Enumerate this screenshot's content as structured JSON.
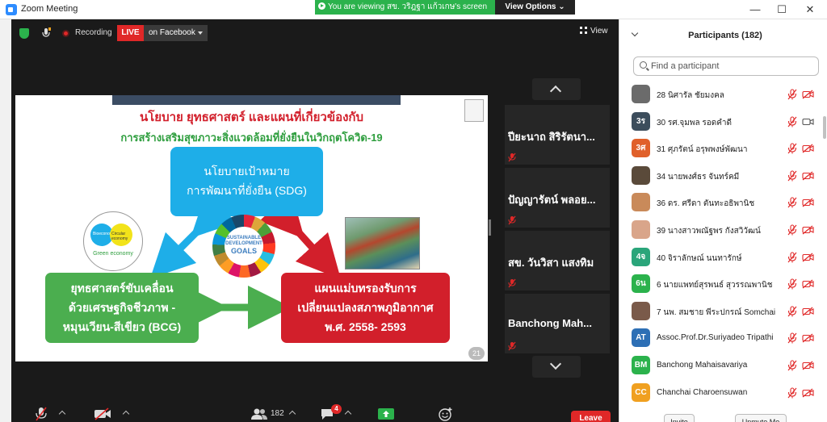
{
  "window": {
    "title": "Zoom Meeting",
    "minimize": "—",
    "maximize": "☐",
    "close": "✕"
  },
  "banner": {
    "viewing": "You are viewing สข. วริฎฐา แก้วเกษ's screen",
    "view_options": "View Options ⌄"
  },
  "meeting_bar": {
    "recording": "Recording",
    "live": "LIVE",
    "on_facebook": "on Facebook",
    "view": "View"
  },
  "slide": {
    "title_line1": "นโยบาย ยุทธศาสตร์ และแผนที่เกี่ยวข้องกับ",
    "title_line2": "การสร้างเสริมสุขภาวะสิ่งแวดล้อมที่ยั่งยืนในวิกฤตโควิด-19",
    "blue_box": [
      "นโยบายเป้าหมาย",
      "การพัฒนาที่ยั่งยืน (SDG)"
    ],
    "green_box": [
      "ยุทธศาสตร์ขับเคลื่อน",
      "ด้วยเศรษฐกิจชีวภาพ -",
      "หมุนเวียน-สีเขียว (BCG)"
    ],
    "red_box": [
      "แผนแม่บทรองรับการ",
      "เปลี่ยนแปลงสภาพภูมิอากาศ",
      "พ.ศ. 2558- 2593"
    ],
    "sdg_logo": [
      "SUSTAINABLE",
      "DEVELOPMENT",
      "GOALS"
    ],
    "bcg_logo": {
      "bio": "Bioeconomy",
      "circular": "Circular economy",
      "green": "Green economy"
    },
    "page_number": "21",
    "colors": {
      "title": "#d21f2b",
      "subtitle": "#2e9e3e",
      "blue": "#1eaee8",
      "green": "#4bae4f",
      "red": "#d21f2b"
    }
  },
  "video_tiles": [
    {
      "name": "ปียะนาถ สิริรัตนา..."
    },
    {
      "name": "ปัญญารัตน์ พลอย..."
    },
    {
      "name": "สข. วันวิสา แสงทิม"
    },
    {
      "name": "Banchong Mah..."
    }
  ],
  "toolbar": {
    "participants_count": "182",
    "chat_badge": "4",
    "leave": "Leave"
  },
  "participants": {
    "header": "Participants (182)",
    "search_placeholder": "Find a participant",
    "items": [
      {
        "initials": "",
        "name": "28 นิศารัล ชัยมงคล",
        "color": "#6b6b6b",
        "cam": "off"
      },
      {
        "initials": "3ร",
        "name": "30 รศ.จุมพล รอดคำดี",
        "color": "#3c4d5c",
        "cam": "on"
      },
      {
        "initials": "3ศ",
        "name": "31 ศุภรัตน์ อรุพพงษ์พัฒนา",
        "color": "#e0602a",
        "cam": "off"
      },
      {
        "initials": "",
        "name": "34 นายพงศ์ธร จันทร์คมี",
        "color": "#5a4a3a",
        "cam": "off"
      },
      {
        "initials": "",
        "name": "36 ดร. ศรีดา ตันทะอธิพานิช",
        "color": "#c98a5a",
        "cam": "off"
      },
      {
        "initials": "",
        "name": "39 นางสาวพณัฐพร กังสวิวัฒน์",
        "color": "#d9a58a",
        "cam": "off"
      },
      {
        "initials": "4จ",
        "name": "40 จิราลักษณ์ นนทารักษ์",
        "color": "#2aa57a",
        "cam": "off"
      },
      {
        "initials": "6น",
        "name": "6 นายแพทย์สุรพนธ์ สุวรรณพานิช",
        "color": "#2bb24c",
        "cam": "off"
      },
      {
        "initials": "",
        "name": "7 นพ. สมชาย พีระปกรณ์ Somchai ...",
        "color": "#7a5a4a",
        "cam": "off"
      },
      {
        "initials": "AT",
        "name": "Assoc.Prof.Dr.Suriyadeo Tripathi",
        "color": "#2d6fb5",
        "cam": "off"
      },
      {
        "initials": "BM",
        "name": "Banchong Mahaisavariya",
        "color": "#2bb24c",
        "cam": "off"
      },
      {
        "initials": "CC",
        "name": "Chanchai Charoensuwan",
        "color": "#f0a020",
        "cam": "off"
      }
    ],
    "invite": "Invite",
    "unmute": "Unmute Me"
  }
}
